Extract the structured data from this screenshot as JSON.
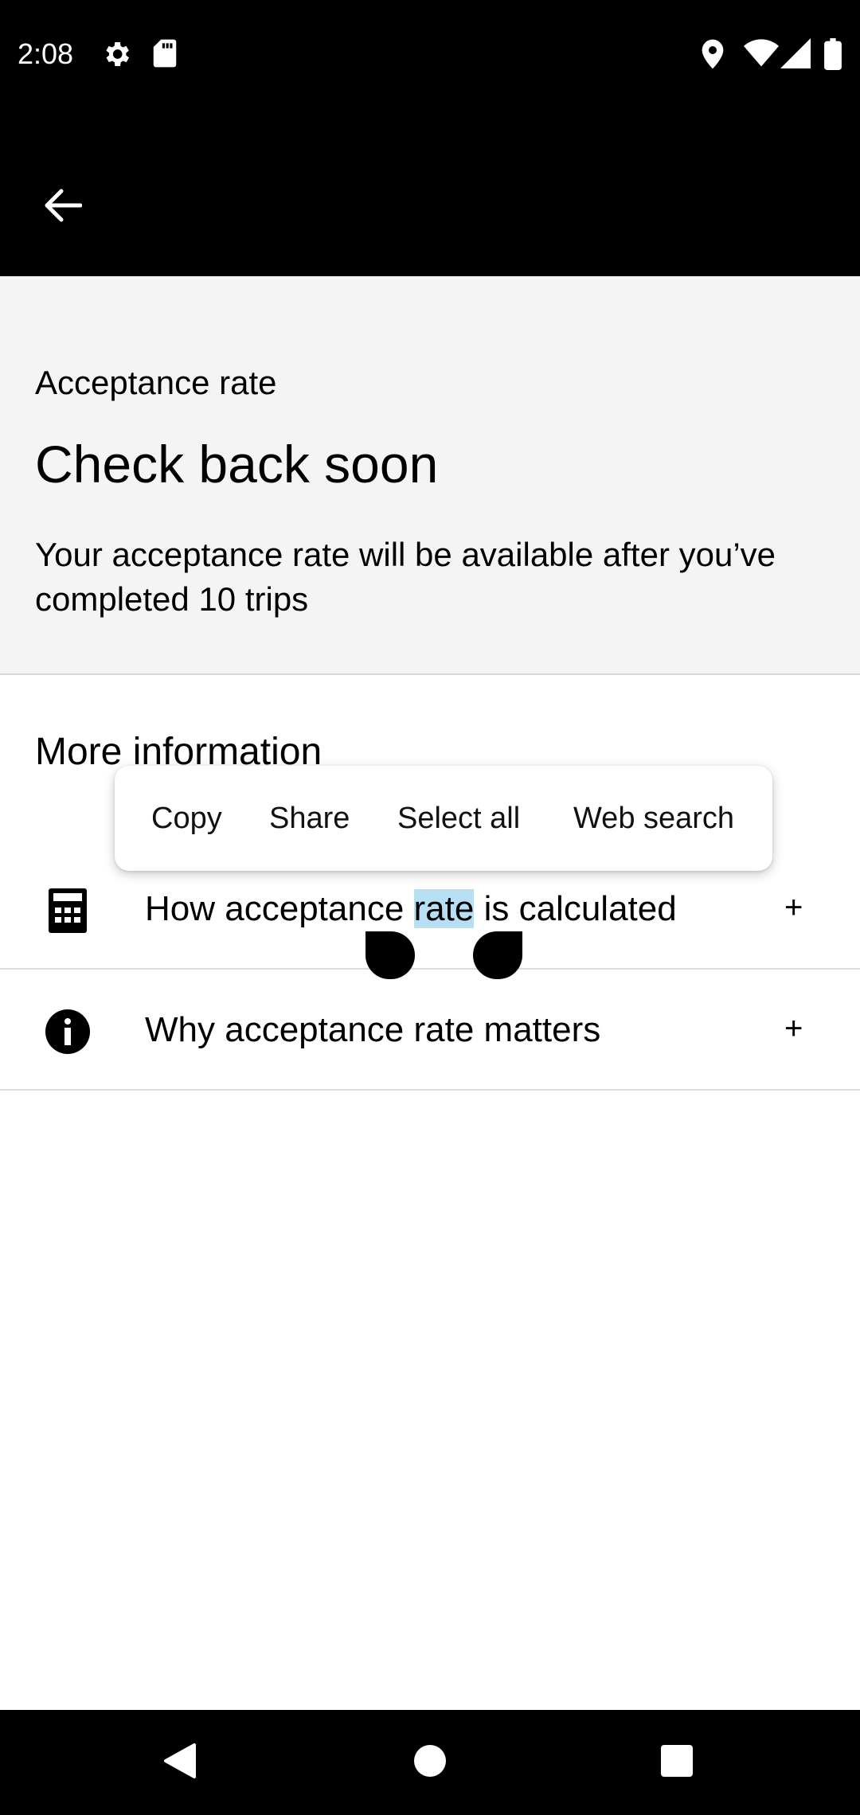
{
  "status_bar": {
    "time": "2:08",
    "left_icons": [
      "gear-icon",
      "sd-card-icon"
    ],
    "right_icons": [
      "location-icon",
      "wifi-icon",
      "signal-icon",
      "battery-icon"
    ]
  },
  "app_bar": {
    "back_icon": "arrow-left-icon"
  },
  "hero": {
    "label": "Acceptance rate",
    "title": "Check back soon",
    "description": "Your acceptance rate will be available after you’ve completed 10 trips"
  },
  "more_info": {
    "title": "More information",
    "items": [
      {
        "icon": "calculator-icon",
        "text_before": "How acceptance ",
        "text_selected": "rate",
        "text_after": " is calculated",
        "expand": "+"
      },
      {
        "icon": "info-icon",
        "text": "Why acceptance rate matters",
        "expand": "+"
      }
    ]
  },
  "selection_popup": {
    "copy": "Copy",
    "share": "Share",
    "select_all": "Select all",
    "web_search": "Web search"
  },
  "colors": {
    "selection_highlight": "#b6dff4",
    "hero_background": "#f4f4f4",
    "bars": "#000000"
  },
  "nav_bar": {
    "icons": [
      "back-triangle-icon",
      "home-circle-icon",
      "recents-square-icon"
    ]
  }
}
